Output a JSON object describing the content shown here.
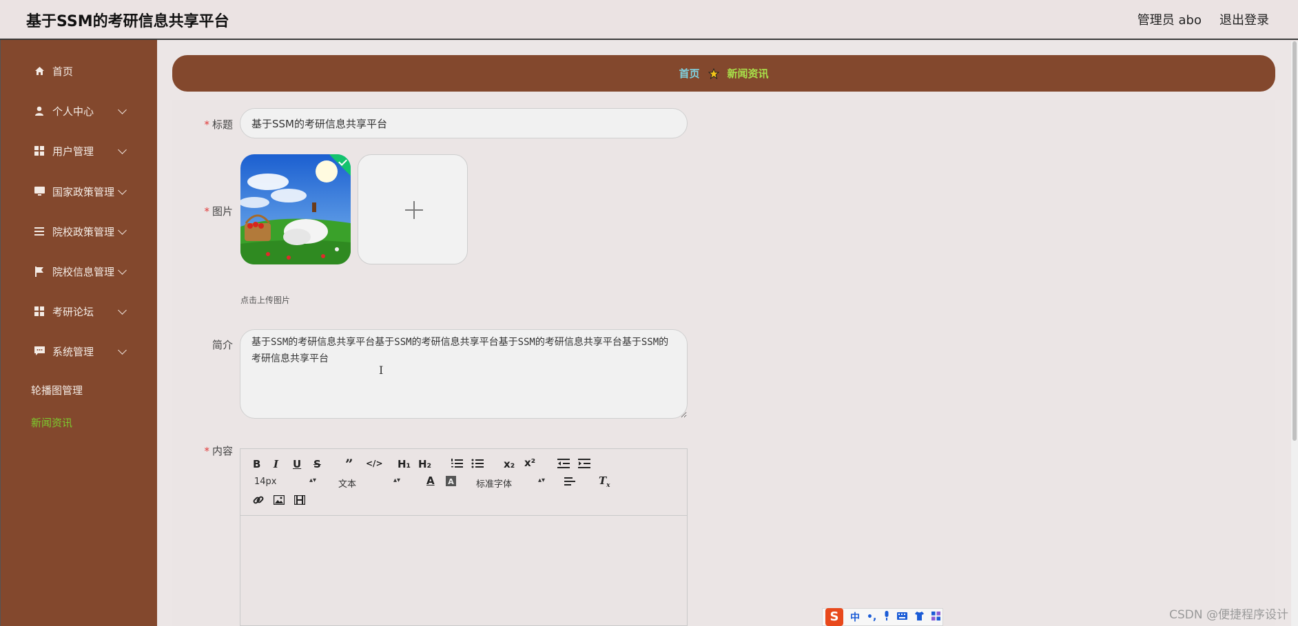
{
  "header": {
    "app_title": "基于SSM的考研信息共享平台",
    "user_label": "管理员 abo",
    "logout_label": "退出登录"
  },
  "sidebar": {
    "items": [
      {
        "label": "首页",
        "icon": "home-icon"
      },
      {
        "label": "个人中心",
        "icon": "user-icon"
      },
      {
        "label": "用户管理",
        "icon": "grid-icon"
      },
      {
        "label": "国家政策管理",
        "icon": "monitor-icon"
      },
      {
        "label": "院校政策管理",
        "icon": "list-icon"
      },
      {
        "label": "院校信息管理",
        "icon": "flag-icon"
      },
      {
        "label": "考研论坛",
        "icon": "grid-icon"
      },
      {
        "label": "系统管理",
        "icon": "chat-icon"
      },
      {
        "label": "轮播图管理"
      },
      {
        "label": "新闻资讯"
      }
    ]
  },
  "breadcrumb": {
    "home": "首页",
    "current": "新闻资讯"
  },
  "form": {
    "title_label": "标题",
    "title_value": "基于SSM的考研信息共享平台",
    "image_label": "图片",
    "upload_hint": "点击上传图片",
    "summary_label": "简介",
    "summary_value": "基于SSM的考研信息共享平台基于SSM的考研信息共享平台基于SSM的考研信息共享平台基于SSM的考研信息共享平台",
    "content_label": "内容"
  },
  "editor": {
    "font_size": "14px",
    "block_type": "文本",
    "font_family": "标准字体",
    "subscript": "x₂",
    "superscript": "x²",
    "h1": "H₁",
    "h2": "H₂"
  },
  "ime": {
    "logo": "S",
    "lang": "中",
    "punct": "•,"
  },
  "watermark": "CSDN @便捷程序设计",
  "colors": {
    "sidebar": "#83482d",
    "active_menu": "#7ccd2e",
    "crumb_home": "#7fd1e0",
    "crumb_current": "#a8e04a",
    "required": "#e03a3a"
  }
}
